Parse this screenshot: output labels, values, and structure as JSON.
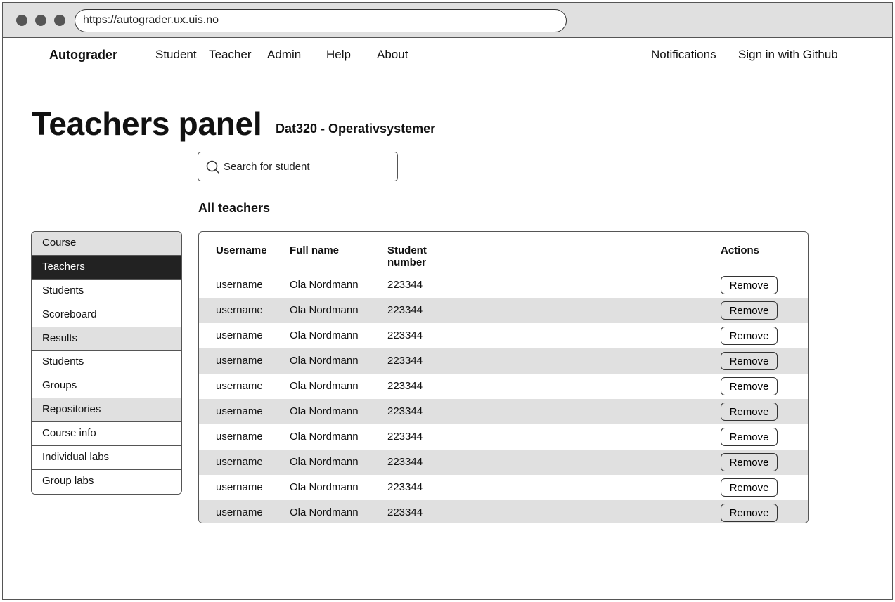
{
  "browser": {
    "url": "https://autograder.ux.uis.no"
  },
  "nav": {
    "brand": "Autograder",
    "links": [
      "Student",
      "Teacher",
      "Admin",
      "Help",
      "About"
    ],
    "notifications": "Notifications",
    "sign_in": "Sign in with Github"
  },
  "page": {
    "title": "Teachers panel",
    "course": "Dat320 - Operativsystemer",
    "search_placeholder": "Search for student",
    "section_title": "All teachers"
  },
  "sidebar": {
    "items": [
      {
        "label": "Course",
        "type": "header"
      },
      {
        "label": "Teachers",
        "type": "active"
      },
      {
        "label": "Students",
        "type": "link"
      },
      {
        "label": "Scoreboard",
        "type": "link"
      },
      {
        "label": "Results",
        "type": "header"
      },
      {
        "label": "Students",
        "type": "link"
      },
      {
        "label": "Groups",
        "type": "link"
      },
      {
        "label": "Repositories",
        "type": "header"
      },
      {
        "label": "Course info",
        "type": "link"
      },
      {
        "label": "Individual labs",
        "type": "link"
      },
      {
        "label": "Group labs",
        "type": "link"
      }
    ]
  },
  "table": {
    "headers": {
      "username": "Username",
      "fullname": "Full name",
      "student_number_1": "Student",
      "student_number_2": "number",
      "actions": "Actions"
    },
    "action_label": "Remove",
    "rows": [
      {
        "username": "username",
        "fullname": "Ola Nordmann",
        "number": "223344"
      },
      {
        "username": "username",
        "fullname": "Ola Nordmann",
        "number": "223344"
      },
      {
        "username": "username",
        "fullname": "Ola Nordmann",
        "number": "223344"
      },
      {
        "username": "username",
        "fullname": "Ola Nordmann",
        "number": "223344"
      },
      {
        "username": "username",
        "fullname": "Ola Nordmann",
        "number": "223344"
      },
      {
        "username": "username",
        "fullname": "Ola Nordmann",
        "number": "223344"
      },
      {
        "username": "username",
        "fullname": "Ola Nordmann",
        "number": "223344"
      },
      {
        "username": "username",
        "fullname": "Ola Nordmann",
        "number": "223344"
      },
      {
        "username": "username",
        "fullname": "Ola Nordmann",
        "number": "223344"
      },
      {
        "username": "username",
        "fullname": "Ola Nordmann",
        "number": "223344"
      }
    ]
  },
  "colors": {
    "header_bg": "#e0e0e0",
    "active_bg": "#222222",
    "border": "#555555"
  }
}
